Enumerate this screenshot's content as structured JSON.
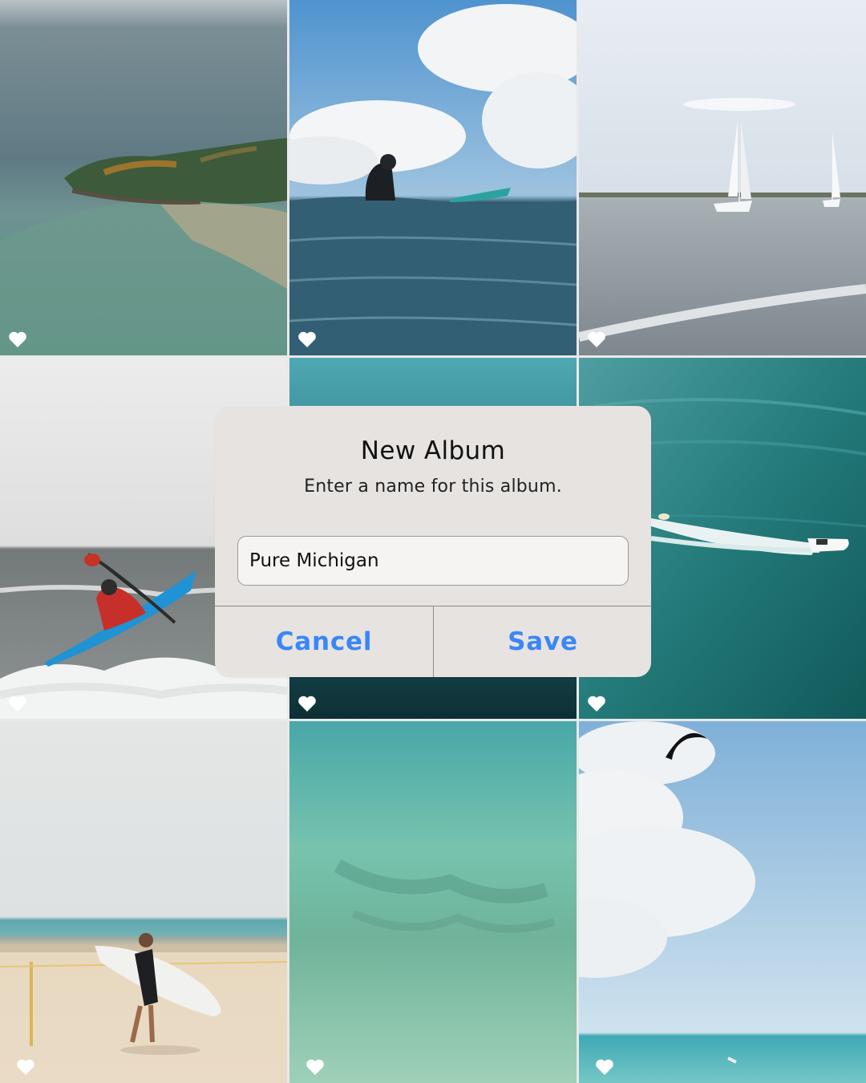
{
  "photos": [
    {
      "subject": "aerial-island"
    },
    {
      "subject": "surfer-in-water"
    },
    {
      "subject": "sailboats"
    },
    {
      "subject": "kayaker"
    },
    {
      "subject": "deep-water"
    },
    {
      "subject": "speedboat"
    },
    {
      "subject": "beach-surfer"
    },
    {
      "subject": "shallow-water"
    },
    {
      "subject": "kitesurfer"
    }
  ],
  "icons": {
    "favorite": "heart-icon"
  },
  "dialog": {
    "title": "New Album",
    "message": "Enter a name for this album.",
    "name_value": "Pure Michigan",
    "cancel_label": "Cancel",
    "save_label": "Save"
  },
  "colors": {
    "accent": "#3b86f7",
    "dialog_bg": "#e6e3e0"
  }
}
